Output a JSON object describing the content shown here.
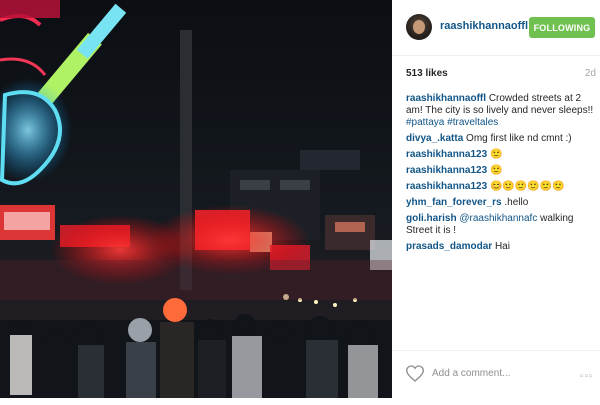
{
  "post": {
    "username": "raashikhannaoffl",
    "follow_label": "FOLLOWING",
    "likes": "513 likes",
    "time": "2d",
    "caption": {
      "user": "raashikhannaoffl",
      "text": "Crowded streets at 2 am! The city is so lively and never sleeps!!",
      "tags": "#pattaya #traveltales"
    },
    "comments": [
      {
        "user": "divya_.katta",
        "text": "Omg first like nd cmnt :)"
      },
      {
        "user": "raashikhanna123",
        "text": "🙂"
      },
      {
        "user": "raashikhanna123",
        "text": "🙂"
      },
      {
        "user": "raashikhanna123",
        "text": "😊🙂🙂🙂🙂🙂"
      },
      {
        "user": "yhm_fan_forever_rs",
        "text": ".hello"
      },
      {
        "user": "goli.harish",
        "mention": "@raashikhannafc",
        "text": "walking Street it is !"
      },
      {
        "user": "prasads_damodar",
        "text": "Hai"
      }
    ],
    "add_comment_placeholder": "Add a comment...",
    "more_label": "▫▫▫"
  },
  "colors": {
    "link": "#125688",
    "follow_bg": "#70c050",
    "muted": "#8e8e8e"
  },
  "icons": {
    "like": "heart-icon",
    "more": "more-options-icon"
  }
}
